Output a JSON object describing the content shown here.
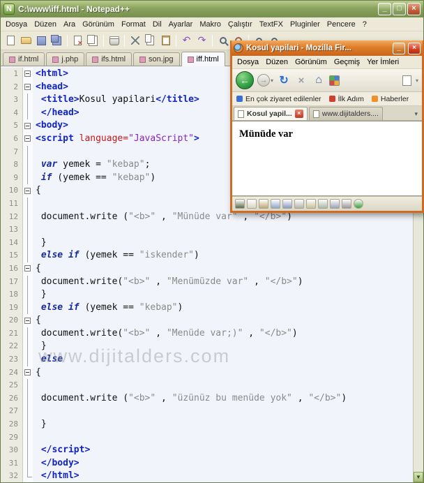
{
  "watermark": "www.dijitalders.com",
  "notepad": {
    "title": "C:\\www\\iff.html - Notepad++",
    "window_buttons": {
      "minimize": "_",
      "restore": "□",
      "close": "×"
    },
    "menu": [
      "Dosya",
      "Düzen",
      "Ara",
      "Görünüm",
      "Format",
      "Dil",
      "Ayarlar",
      "Makro",
      "Çalıştır",
      "TextFX",
      "Pluginler",
      "Pencere",
      "?"
    ],
    "toolbar_icons": [
      "new-file",
      "open-file",
      "save",
      "save-all",
      "|",
      "close",
      "close-all",
      "|",
      "print",
      "|",
      "cut",
      "copy",
      "paste",
      "|",
      "undo",
      "redo",
      "|",
      "find",
      "replace",
      "|",
      "zoom-in",
      "zoom-out"
    ],
    "tabs": [
      {
        "label": "if.html",
        "active": false
      },
      {
        "label": "j.php",
        "active": false
      },
      {
        "label": "ifs.html",
        "active": false
      },
      {
        "label": "son.jpg",
        "active": false
      },
      {
        "label": "iff.html",
        "active": true
      }
    ],
    "lines": [
      {
        "n": 1,
        "fold": "start",
        "seg": [
          [
            "<html>",
            "tag"
          ]
        ]
      },
      {
        "n": 2,
        "fold": "start",
        "seg": [
          [
            "<head>",
            "tag"
          ]
        ]
      },
      {
        "n": 3,
        "fold": "mid",
        "seg": [
          [
            " ",
            "pl"
          ],
          [
            "<title>",
            "tag"
          ],
          [
            "Kosul yapilari",
            "pl"
          ],
          [
            "</title>",
            "tag"
          ]
        ]
      },
      {
        "n": 4,
        "fold": "mid",
        "seg": [
          [
            " ",
            "pl"
          ],
          [
            "</head>",
            "tag"
          ]
        ]
      },
      {
        "n": 5,
        "fold": "start",
        "seg": [
          [
            "<body>",
            "tag"
          ]
        ]
      },
      {
        "n": 6,
        "fold": "start",
        "seg": [
          [
            "<script ",
            "tag"
          ],
          [
            "language=",
            "attr"
          ],
          [
            "\"JavaScript\"",
            "val"
          ],
          [
            ">",
            "tag"
          ]
        ]
      },
      {
        "n": 7,
        "fold": "mid",
        "seg": []
      },
      {
        "n": 8,
        "fold": "mid",
        "seg": [
          [
            " ",
            "pl"
          ],
          [
            "var",
            "kw"
          ],
          [
            " yemek = ",
            "pl"
          ],
          [
            "\"kebap\"",
            "str"
          ],
          [
            ";",
            "pl"
          ]
        ]
      },
      {
        "n": 9,
        "fold": "mid",
        "seg": [
          [
            " ",
            "pl"
          ],
          [
            "if",
            "kw"
          ],
          [
            " (yemek == ",
            "pl"
          ],
          [
            "\"kebap\"",
            "str"
          ],
          [
            ")",
            "pl"
          ]
        ]
      },
      {
        "n": 10,
        "fold": "start",
        "seg": [
          [
            "{",
            "pl"
          ]
        ]
      },
      {
        "n": 11,
        "fold": "mid",
        "seg": []
      },
      {
        "n": 12,
        "fold": "mid",
        "seg": [
          [
            " document.write (",
            "pl"
          ],
          [
            "\"<b>\"",
            "str"
          ],
          [
            " , ",
            "pl"
          ],
          [
            "\"Münüde var\"",
            "str"
          ],
          [
            " , ",
            "pl"
          ],
          [
            "\"</b>\"",
            "str"
          ],
          [
            ")",
            "pl"
          ]
        ]
      },
      {
        "n": 13,
        "fold": "mid",
        "seg": []
      },
      {
        "n": 14,
        "fold": "mid",
        "seg": [
          [
            " }",
            "pl"
          ]
        ]
      },
      {
        "n": 15,
        "fold": "mid",
        "seg": [
          [
            " ",
            "pl"
          ],
          [
            "else if",
            "kw"
          ],
          [
            " (yemek == ",
            "pl"
          ],
          [
            "\"iskender\"",
            "str"
          ],
          [
            ")",
            "pl"
          ]
        ]
      },
      {
        "n": 16,
        "fold": "start",
        "seg": [
          [
            "{",
            "pl"
          ]
        ]
      },
      {
        "n": 17,
        "fold": "mid",
        "seg": [
          [
            " document.write(",
            "pl"
          ],
          [
            "\"<b>\"",
            "str"
          ],
          [
            " , ",
            "pl"
          ],
          [
            "\"Menümüzde var\"",
            "str"
          ],
          [
            " , ",
            "pl"
          ],
          [
            "\"</b>\"",
            "str"
          ],
          [
            ")",
            "pl"
          ]
        ]
      },
      {
        "n": 18,
        "fold": "mid",
        "seg": [
          [
            " }",
            "pl"
          ]
        ]
      },
      {
        "n": 19,
        "fold": "mid",
        "seg": [
          [
            " ",
            "pl"
          ],
          [
            "else if",
            "kw"
          ],
          [
            " (yemek == ",
            "pl"
          ],
          [
            "\"kebap\"",
            "str"
          ],
          [
            ")",
            "pl"
          ]
        ]
      },
      {
        "n": 20,
        "fold": "start",
        "seg": [
          [
            "{",
            "pl"
          ]
        ]
      },
      {
        "n": 21,
        "fold": "mid",
        "seg": [
          [
            " document.write(",
            "pl"
          ],
          [
            "\"<b>\"",
            "str"
          ],
          [
            " , ",
            "pl"
          ],
          [
            "\"Menüde var;)\"",
            "str"
          ],
          [
            " , ",
            "pl"
          ],
          [
            "\"</b>\"",
            "str"
          ],
          [
            ")",
            "pl"
          ]
        ]
      },
      {
        "n": 22,
        "fold": "mid",
        "seg": [
          [
            " }",
            "pl"
          ]
        ]
      },
      {
        "n": 23,
        "fold": "mid",
        "seg": [
          [
            " ",
            "pl"
          ],
          [
            "else",
            "kw"
          ]
        ]
      },
      {
        "n": 24,
        "fold": "start",
        "seg": [
          [
            "{",
            "pl"
          ]
        ]
      },
      {
        "n": 25,
        "fold": "mid",
        "seg": []
      },
      {
        "n": 26,
        "fold": "mid",
        "seg": [
          [
            " document.write (",
            "pl"
          ],
          [
            "\"<b>\"",
            "str"
          ],
          [
            " , ",
            "pl"
          ],
          [
            "\"üzünüz bu menüde yok\"",
            "str"
          ],
          [
            " , ",
            "pl"
          ],
          [
            "\"</b>\"",
            "str"
          ],
          [
            ")",
            "pl"
          ]
        ]
      },
      {
        "n": 27,
        "fold": "mid",
        "seg": []
      },
      {
        "n": 28,
        "fold": "mid",
        "seg": [
          [
            " }",
            "pl"
          ]
        ]
      },
      {
        "n": 29,
        "fold": "mid",
        "seg": []
      },
      {
        "n": 30,
        "fold": "mid",
        "seg": [
          [
            " ",
            "pl"
          ],
          [
            "</script>",
            "tag"
          ]
        ]
      },
      {
        "n": 31,
        "fold": "mid",
        "seg": [
          [
            " ",
            "pl"
          ],
          [
            "</body>",
            "tag"
          ]
        ]
      },
      {
        "n": 32,
        "fold": "end",
        "seg": [
          [
            " ",
            "pl"
          ],
          [
            "</html>",
            "tag"
          ]
        ]
      }
    ]
  },
  "firefox": {
    "title": "Kosul yapilari - Mozilla Fir...",
    "window_buttons": {
      "minimize": "_",
      "close": "×"
    },
    "menu": [
      "Dosya",
      "Düzen",
      "Görünüm",
      "Geçmiş",
      "Yer İmleri"
    ],
    "bookmarks": [
      {
        "label": "En çok ziyaret edilenler",
        "color": "#3a6fd0"
      },
      {
        "label": "İlk Adım",
        "color": "#d0402e"
      },
      {
        "label": "Haberler",
        "color": "#f0902a"
      }
    ],
    "tabs": [
      {
        "label": "Kosul yapil...",
        "active": true,
        "closable": true
      },
      {
        "label": "www.dijitalders....",
        "active": false,
        "closable": false
      }
    ],
    "content_text": "Münüde var",
    "status_icons": [
      {
        "name": "web-developer-icon",
        "color": "#5a6a4a",
        "round": false
      },
      {
        "name": "document-icon",
        "color": "#d8d4c4",
        "round": false
      },
      {
        "name": "edit-icon",
        "color": "#c0a878",
        "round": false
      },
      {
        "name": "image-icon",
        "color": "#8aa8c8",
        "round": false
      },
      {
        "name": "save-icon",
        "color": "#8a9ac0",
        "round": false
      },
      {
        "name": "print-icon",
        "color": "#b4b4aa",
        "round": false
      },
      {
        "name": "frame-icon",
        "color": "#c8c09c",
        "round": false
      },
      {
        "name": "layout-icon",
        "color": "#a8b8a0",
        "round": false
      },
      {
        "name": "resize-icon",
        "color": "#9aa4b4",
        "round": false
      },
      {
        "name": "tools-icon",
        "color": "#98989e",
        "round": false
      },
      {
        "name": "info-icon",
        "color": "#3a9e3a",
        "round": true
      }
    ]
  }
}
